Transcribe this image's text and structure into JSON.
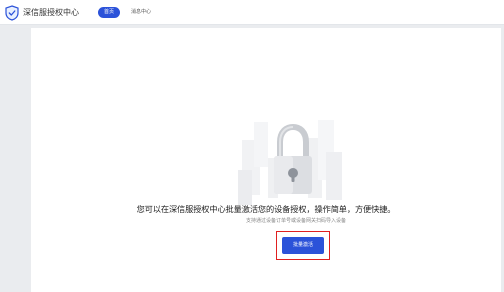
{
  "header": {
    "title": "深信服授权中心",
    "logo_icon": "shield-check-icon",
    "nav": {
      "home_label": "首页",
      "messages_label": "消息中心"
    }
  },
  "main": {
    "illustration_icon": "padlock-icon",
    "message": "您可以在深信服授权中心批量激活您的设备授权，操作简单，方便快捷。",
    "sub_message": "支持通过设备订单号或设备网关扫码导入设备",
    "activate_button_label": "批量激活"
  },
  "colors": {
    "accent": "#2b52d9",
    "highlight": "#e02020",
    "background": "#eaecef"
  }
}
